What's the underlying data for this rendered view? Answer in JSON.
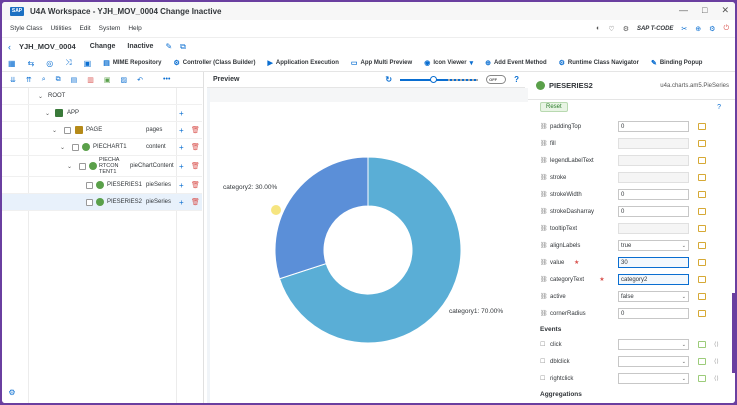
{
  "window": {
    "title": "U4A Workspace - YJH_MOV_0004 Change Inactive",
    "logo": "SAP"
  },
  "menu": {
    "items": [
      "Style Class",
      "Utilities",
      "Edit",
      "System",
      "Help"
    ],
    "tcode_label": "SAP T-CODE"
  },
  "header": {
    "app_id": "YJH_MOV_0004",
    "mode": "Change",
    "status": "Inactive"
  },
  "toolbar": {
    "buttons": [
      "MIME Repository",
      "Controller (Class Builder)",
      "Application Execution",
      "App Multi Preview",
      "Icon Viewer",
      "Add Event Method",
      "Runtime Class Navigator",
      "Binding Popup"
    ]
  },
  "tree": {
    "rows": [
      {
        "label": "ROOT",
        "agg": ""
      },
      {
        "label": "APP",
        "agg": ""
      },
      {
        "label": "PAGE",
        "agg": "pages"
      },
      {
        "label": "PIECHART1",
        "agg": "content"
      },
      {
        "label": "PIECHA RTCON TENT1",
        "agg": "pieChartContent"
      },
      {
        "label": "PIESERIES1",
        "agg": "pieSeries"
      },
      {
        "label": "PIESERIES2",
        "agg": "pieSeries"
      }
    ]
  },
  "preview": {
    "title": "Preview",
    "toggle_label": "OFF"
  },
  "chart_data": {
    "type": "pie",
    "donut": true,
    "slices": [
      {
        "name": "category1",
        "value": 70,
        "label": "category1: 70.00%",
        "color": "#5aaed6"
      },
      {
        "name": "category2",
        "value": 30,
        "label": "category2: 30.00%",
        "color": "#5b8fd8"
      }
    ]
  },
  "properties": {
    "object_name": "PIESERIES2",
    "class_name": "u4a.charts.am5.PieSeries",
    "reset_label": "Reset",
    "rows": [
      {
        "name": "paddingTop",
        "value": "0",
        "kind": "text"
      },
      {
        "name": "fill",
        "value": "",
        "kind": "empty"
      },
      {
        "name": "legendLabelText",
        "value": "",
        "kind": "empty"
      },
      {
        "name": "stroke",
        "value": "",
        "kind": "empty"
      },
      {
        "name": "strokeWidth",
        "value": "0",
        "kind": "text"
      },
      {
        "name": "strokeDasharray",
        "value": "0",
        "kind": "text"
      },
      {
        "name": "tooltipText",
        "value": "",
        "kind": "empty"
      },
      {
        "name": "alignLabels",
        "value": "true",
        "kind": "select"
      },
      {
        "name": "value",
        "value": "30",
        "kind": "focus",
        "required": true
      },
      {
        "name": "categoryText",
        "value": "category2",
        "kind": "focus",
        "required": true
      },
      {
        "name": "active",
        "value": "false",
        "kind": "select"
      },
      {
        "name": "cornerRadius",
        "value": "0",
        "kind": "text"
      }
    ],
    "events_label": "Events",
    "events": [
      "click",
      "dblclick",
      "rightclick"
    ],
    "aggregations_label": "Aggregations"
  },
  "colors": {
    "accent": "#0a6ed1",
    "frame": "#6a3fa0"
  }
}
